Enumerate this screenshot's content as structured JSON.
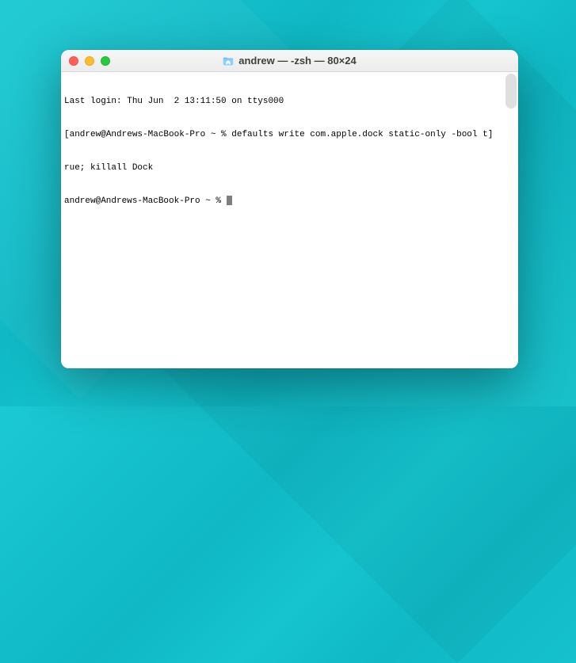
{
  "window": {
    "title": "andrew — -zsh — 80×24"
  },
  "terminal": {
    "last_login": "Last login: Thu Jun  2 13:11:50 on ttys000",
    "prompt1": "andrew@Andrews-MacBook-Pro ~ % ",
    "cmd1_line1": "defaults write com.apple.dock static-only -bool t",
    "cmd1_line2": "rue; killall Dock",
    "prompt2": "andrew@Andrews-MacBook-Pro ~ % "
  }
}
